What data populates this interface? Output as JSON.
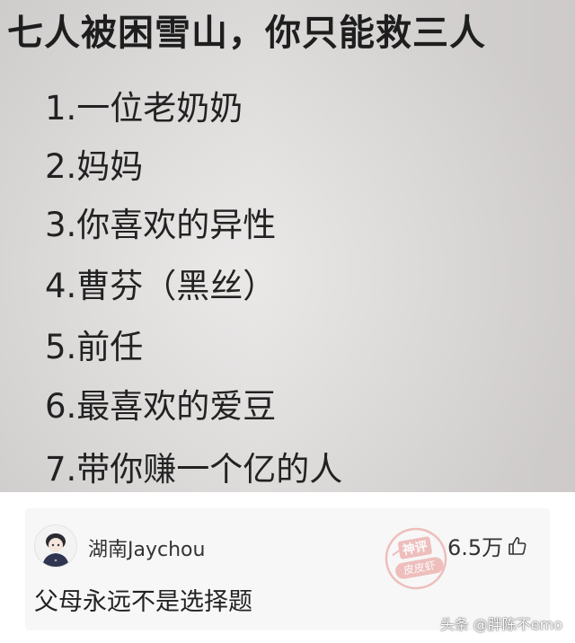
{
  "poster": {
    "title": "七人被困雪山，你只能救三人",
    "options": [
      "1.一位老奶奶",
      "2.妈妈",
      "3.你喜欢的异性",
      "4.曹芬（黑丝）",
      "5.前任",
      "6.最喜欢的爱豆",
      "7.带你赚一个亿的人"
    ]
  },
  "comment": {
    "username": "湖南Jaychou",
    "likes": "6.5万",
    "text": "父母永远不是选择题",
    "stamp_top": "神评",
    "stamp_bottom": "皮皮虾",
    "stamp_color": "#e8908d"
  },
  "watermark": "头条 @胖陈不emo",
  "icons": {
    "like": "thumbs-up-icon",
    "avatar": "avatar"
  }
}
